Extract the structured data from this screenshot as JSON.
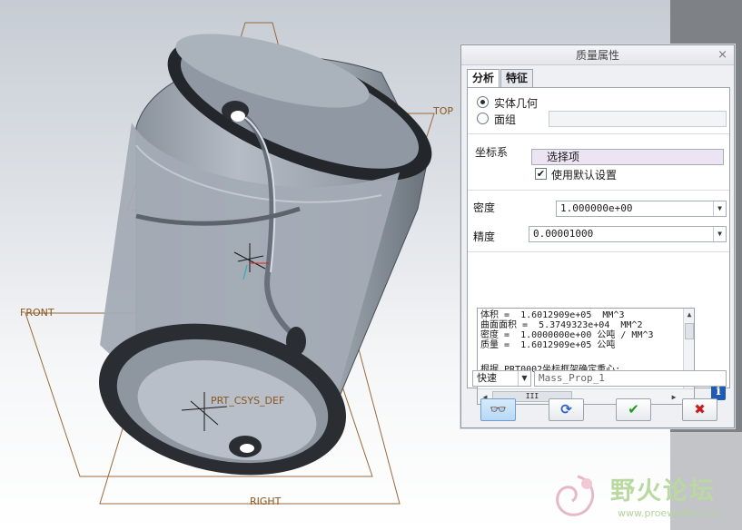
{
  "viewport": {
    "plane_labels": {
      "top": "TOP",
      "front": "FRONT",
      "right": "RIGHT",
      "csys": "PRT_CSYS_DEF"
    }
  },
  "dialog": {
    "title": "质量属性",
    "close": "×",
    "tabs": [
      {
        "label": "分析",
        "active": true
      },
      {
        "label": "特征",
        "active": false
      }
    ],
    "geometry_options": [
      {
        "label": "实体几何",
        "selected": true
      },
      {
        "label": "面组",
        "selected": false
      }
    ],
    "coord_sys_label": "坐标系",
    "coord_sys_value": "选择项",
    "use_default_label": "使用默认设置",
    "use_default_checked": "✔",
    "density_label": "密度",
    "density_value": "1.000000e+00",
    "precision_label": "精度",
    "precision_value": "0.00001000",
    "results": [
      "体积 =  1.6012909e+05  MM^3",
      "曲面面积 =  5.3749323e+04  MM^2",
      "密度 =  1.0000000e+00 公吨 / MM^3",
      "质量 =  1.6012909e+05 公吨",
      "",
      "根据_PRT0002坐标框架确定重心:"
    ],
    "scroll_thumb": "III",
    "info": "i",
    "mode_value": "快速",
    "name_value": "Mass_Prop_1",
    "buttons": {
      "preview": "👓",
      "repaint": "⟳",
      "ok": "✔",
      "cancel": "✖"
    },
    "colors": {
      "ok": "#1e9a1e",
      "cancel": "#c81e1e",
      "repaint": "#2a62c8"
    }
  },
  "watermark": {
    "title": "野火论坛",
    "url": "www.proewildfire.cn"
  }
}
